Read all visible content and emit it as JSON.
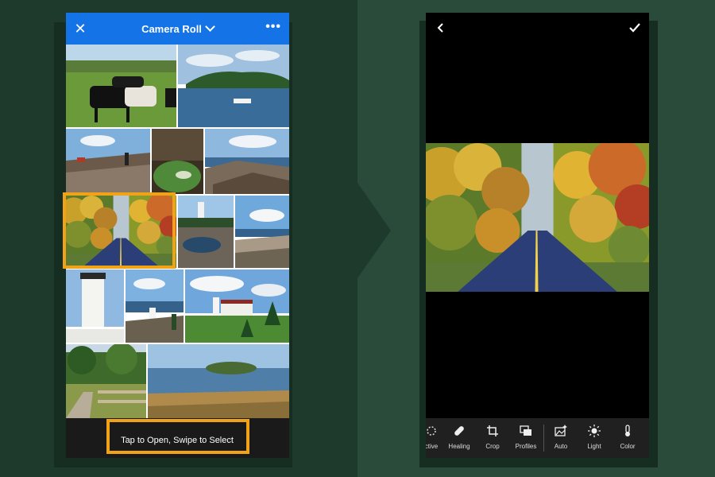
{
  "left_screen": {
    "header": {
      "close_icon": "close-icon",
      "title": "Camera Roll",
      "dropdown_icon": "chevron-down-icon",
      "more_icon": "more-icon"
    },
    "footer": {
      "hint": "Tap to Open, Swipe to Select"
    },
    "photos": [
      "cows",
      "harbor",
      "rocky-coast-hiker",
      "tide-pool",
      "rocky-shore",
      "autumn-road",
      "lighthouse-rocks",
      "rocky-beach",
      "white-lighthouse",
      "coastal-lighthouse",
      "lighthouse-house",
      "fence-path",
      "island-bay"
    ],
    "selected_photo": "autumn-road",
    "highlight_color": "#f0a316",
    "header_color": "#1473e6"
  },
  "right_screen": {
    "back_icon": "back-chevron-icon",
    "confirm_icon": "checkmark-icon",
    "tools": [
      {
        "label": "ctive",
        "icon": "selective-icon"
      },
      {
        "label": "Healing",
        "icon": "bandage-icon"
      },
      {
        "label": "Crop",
        "icon": "crop-icon"
      },
      {
        "label": "Profiles",
        "icon": "profiles-icon"
      },
      {
        "label": "Auto",
        "icon": "auto-icon"
      },
      {
        "label": "Light",
        "icon": "sun-icon"
      },
      {
        "label": "Color",
        "icon": "thermometer-icon"
      }
    ]
  },
  "background_colors": {
    "left": "#1e3a2c",
    "right": "#2a4b39"
  }
}
